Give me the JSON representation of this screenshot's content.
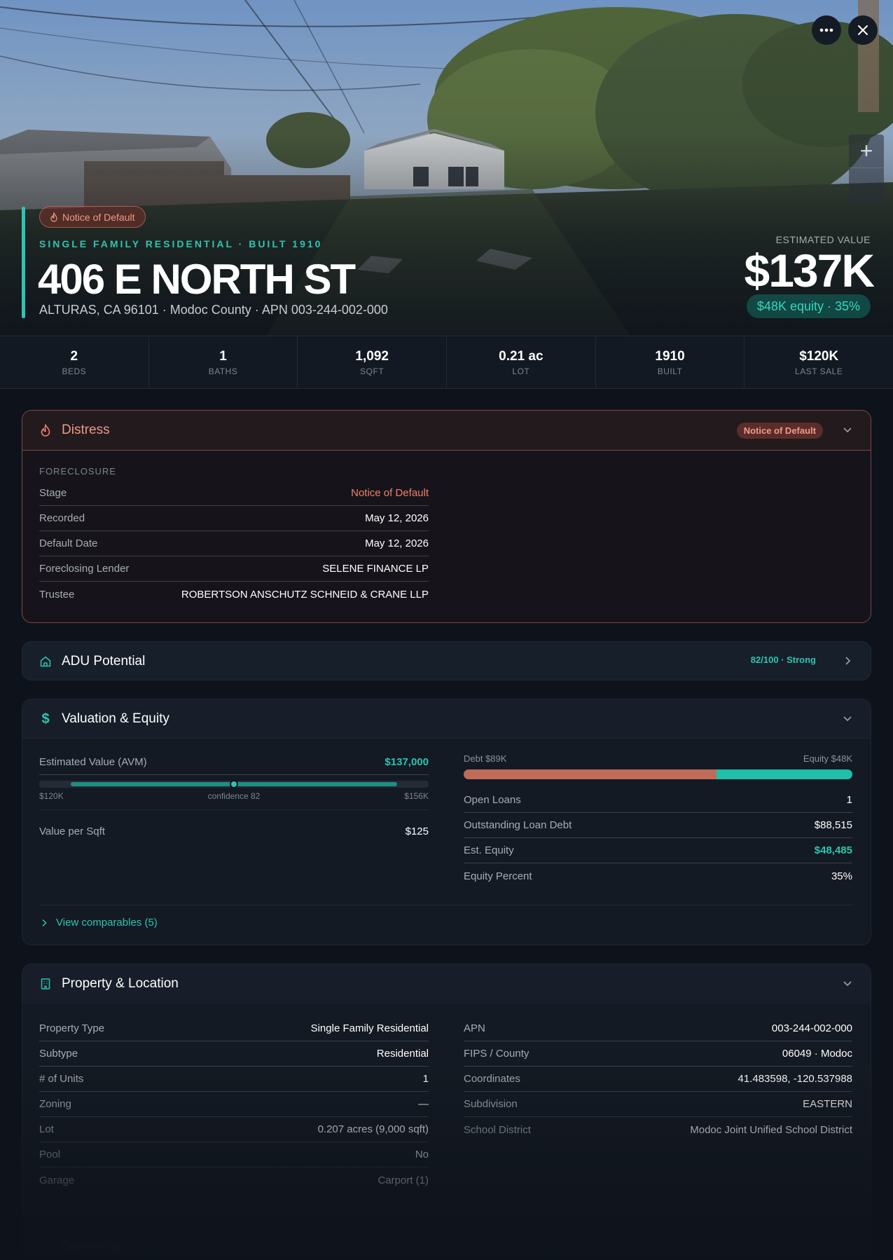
{
  "hero": {
    "distress_pill": "Notice of Default",
    "type_line": "SINGLE FAMILY RESIDENTIAL · BUILT 1910",
    "address": "406 E NORTH ST",
    "subline": "ALTURAS, CA 96101 · Modoc County · APN 003-244-002-000",
    "est_label": "ESTIMATED VALUE",
    "est_value": "$137K",
    "equity_pill": "$48K equity · 35%",
    "more_icon": "more-icon",
    "close_icon": "close-icon"
  },
  "stats": [
    {
      "value": "2",
      "label": "BEDS"
    },
    {
      "value": "1",
      "label": "BATHS"
    },
    {
      "value": "1,092",
      "label": "SQFT"
    },
    {
      "value": "0.21 ac",
      "label": "LOT"
    },
    {
      "value": "1910",
      "label": "BUILT"
    },
    {
      "value": "$120K",
      "label": "LAST SALE"
    }
  ],
  "distress": {
    "title": "Distress",
    "badge": "Notice of Default",
    "section": "FORECLOSURE",
    "rows": [
      {
        "k": "Stage",
        "v": "Notice of Default"
      },
      {
        "k": "Recorded",
        "v": "May 12, 2026"
      },
      {
        "k": "Default Date",
        "v": "May 12, 2026"
      },
      {
        "k": "Foreclosing Lender",
        "v": "SELENE FINANCE LP"
      },
      {
        "k": "Trustee",
        "v": "ROBERTSON ANSCHUTZ SCHNEID & CRANE LLP"
      }
    ]
  },
  "adu": {
    "title": "ADU Potential",
    "score": "82/100 · Strong"
  },
  "valuation": {
    "title": "Valuation & Equity",
    "avm_label": "Estimated Value (AVM)",
    "avm_value": "$137,000",
    "range_low": "$120K",
    "range_mid": "confidence 82",
    "range_high": "$156K",
    "avm_position": 0.5,
    "ppsf_label": "Value per Sqft",
    "ppsf_value": "$125",
    "debt_label": "Debt $89K",
    "equity_label": "Equity $48K",
    "debt_fraction": 0.65,
    "loans": [
      {
        "k": "Open Loans",
        "v": "1"
      },
      {
        "k": "Outstanding Loan Debt",
        "v": "$88,515"
      },
      {
        "k": "Est. Equity",
        "v": "$48,485"
      },
      {
        "k": "Equity Percent",
        "v": "35%"
      }
    ],
    "comps_link": "View comparables (5)"
  },
  "property": {
    "title": "Property & Location",
    "left": [
      {
        "k": "Property Type",
        "v": "Single Family Residential"
      },
      {
        "k": "Subtype",
        "v": "Residential"
      },
      {
        "k": "# of Units",
        "v": "1"
      },
      {
        "k": "Zoning",
        "v": "—"
      },
      {
        "k": "Lot",
        "v": "0.207 acres (9,000 sqft)"
      },
      {
        "k": "Pool",
        "v": "No"
      },
      {
        "k": "Garage",
        "v": "Carport (1)"
      }
    ],
    "right": [
      {
        "k": "APN",
        "v": "003-244-002-000"
      },
      {
        "k": "FIPS / County",
        "v": "06049 · Modoc"
      },
      {
        "k": "Coordinates",
        "v": "41.483598, -120.537988"
      },
      {
        "k": "Subdivision",
        "v": "EASTERN"
      },
      {
        "k": "School District",
        "v": "Modoc Joint Unified School District"
      }
    ]
  },
  "ownership": {
    "title": "Ownership"
  },
  "colors": {
    "accent": "#2ec4b0",
    "distress": "#f0806a",
    "debt_bar": "#c06a58",
    "background": "#0e131b"
  }
}
